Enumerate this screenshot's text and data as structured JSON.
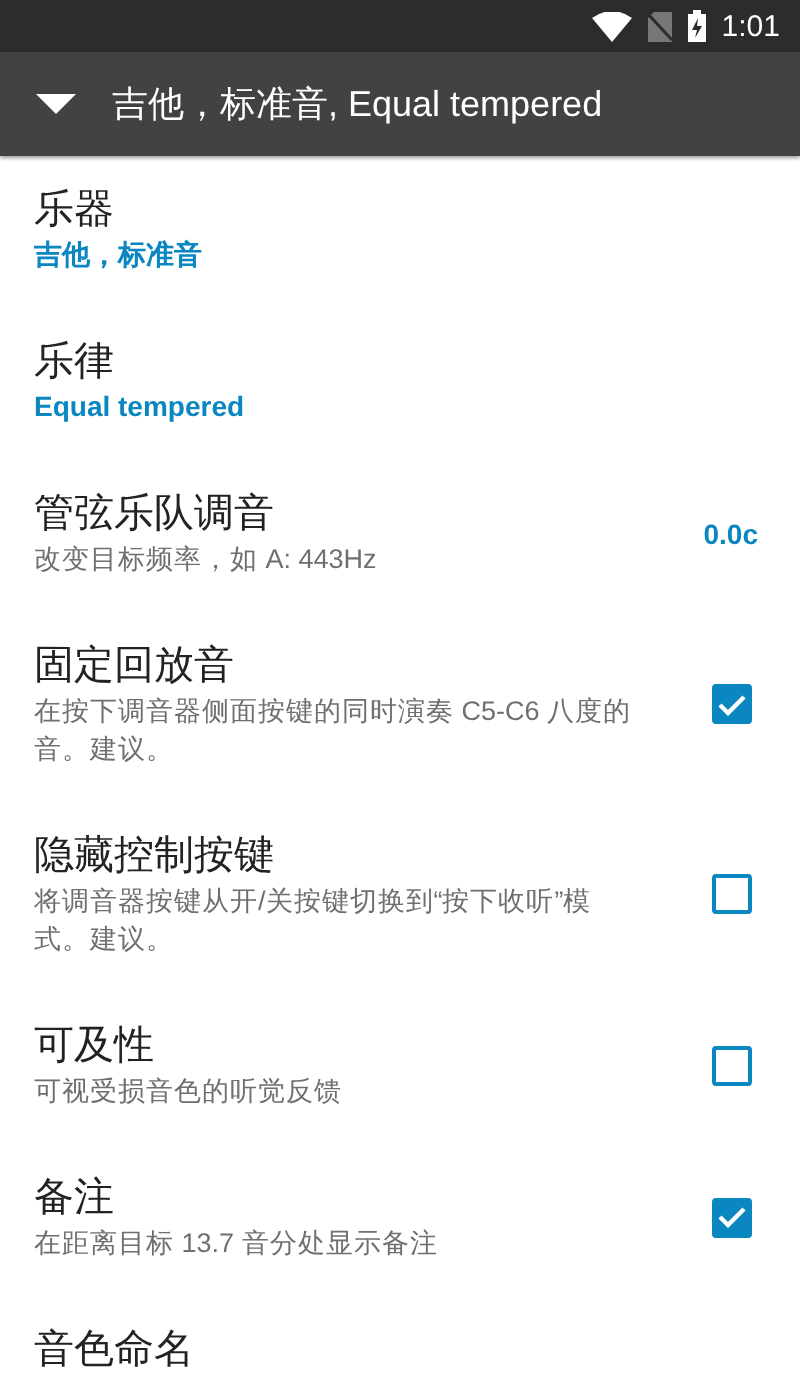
{
  "status_bar": {
    "time": "1:01"
  },
  "toolbar": {
    "title": "吉他，标准音, Equal tempered",
    "expanded": false
  },
  "settings": [
    {
      "kind": "value",
      "title": "乐器",
      "summary": "吉他，标准音"
    },
    {
      "kind": "value",
      "title": "乐律",
      "summary": "Equal tempered"
    },
    {
      "kind": "reading",
      "title": "管弦乐队调音",
      "summary": "改变目标频率，如 A: 443Hz",
      "reading": "0.0c"
    },
    {
      "kind": "checkbox",
      "title": "固定回放音",
      "summary": "在按下调音器侧面按键的同时演奏 C5-C6 八度的音。建议。",
      "checked": true
    },
    {
      "kind": "checkbox",
      "title": "隐藏控制按键",
      "summary": "将调音器按键从开/关按键切换到“按下收听”模式。建议。",
      "checked": false
    },
    {
      "kind": "checkbox",
      "title": "可及性",
      "summary": "可视受损音色的听觉反馈",
      "checked": false
    },
    {
      "kind": "checkbox",
      "title": "备注",
      "summary": "在距离目标 13.7 音分处显示备注",
      "checked": true
    },
    {
      "kind": "value",
      "title": "音色命名"
    }
  ]
}
